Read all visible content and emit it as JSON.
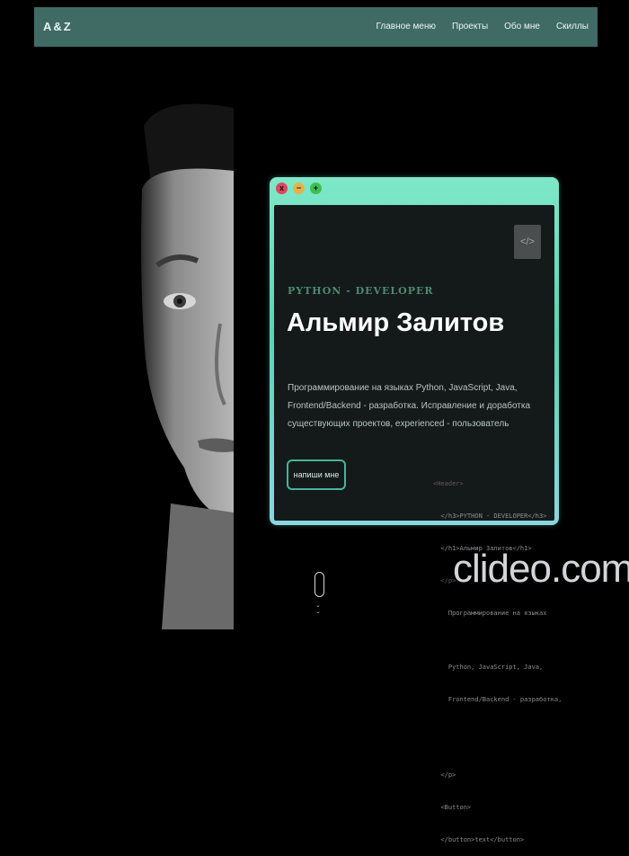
{
  "header": {
    "logo": "A&Z",
    "nav": [
      "Главное меню",
      "Проекты",
      "Обо мне",
      "Скиллы"
    ]
  },
  "window": {
    "controls": [
      "x",
      "−",
      "+"
    ],
    "code_badge": "</>"
  },
  "hero": {
    "subtitle": "PYTHON - DEVELOPER",
    "name": "Альмир Залитов",
    "description": "Программирование на языках Python, JavaScript, Java, Frontend/Backend - разработка. Исправление и доработка существующих проектов, experienced - пользователь",
    "cta_label": "напиши мне"
  },
  "code_snippet": [
    "<Header>",
    "  </h3>PYTHON - DEVELOPER</h3>",
    "  </h1>Альмир Залитов</h1>",
    "  </p>",
    "    Программирование на языках",
    "",
    "    Python, JavaScript, Java,",
    "    Frontend/Backend - разработка,",
    "",
    "",
    "  </p>",
    "  <Button>",
    "  </button>text</button>"
  ],
  "watermark": "clideo.com",
  "colors": {
    "header_bg": "#3f6b64",
    "accent": "#47b49a",
    "terminal_bg": "#141a1a"
  },
  "icons": [
    "close-icon",
    "minimize-icon",
    "maximize-icon",
    "code-icon",
    "mouse-scroll-icon",
    "chevron-down-icon"
  ]
}
